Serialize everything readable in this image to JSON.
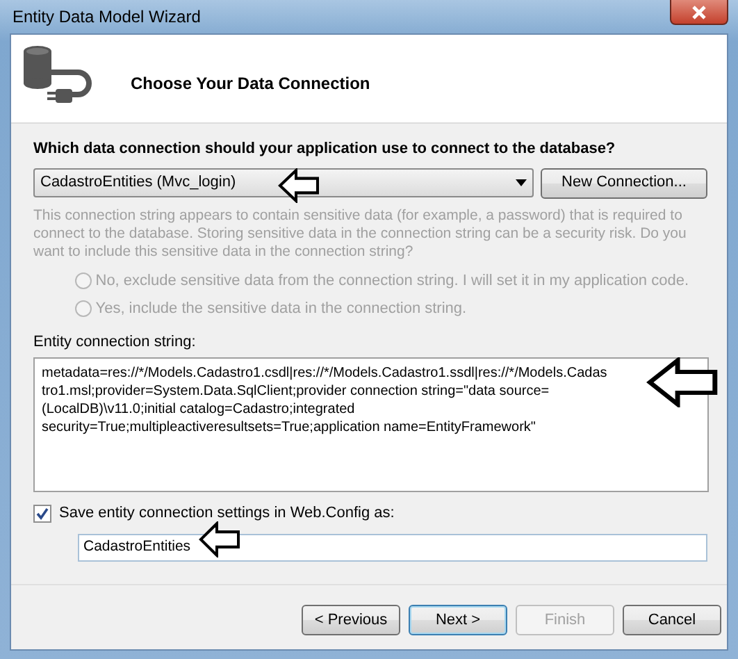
{
  "window": {
    "title": "Entity Data Model Wizard"
  },
  "header": {
    "title": "Choose Your Data Connection"
  },
  "connection": {
    "question": "Which data connection should your application use to connect to the database?",
    "value": "CadastroEntities (Mvc_login)",
    "new_button": "New Connection..."
  },
  "sensitive": {
    "text": "This connection string appears to contain sensitive data (for example, a password) that is required to connect to the database. Storing sensitive data in the connection string can be a security risk. Do you want to include this sensitive data in the connection string?",
    "disabled": true,
    "options": [
      {
        "label": "No, exclude sensitive data from the connection string. I will set it in my application code.",
        "selected": false
      },
      {
        "label": "Yes, include the sensitive data in the connection string.",
        "selected": false
      }
    ]
  },
  "entity": {
    "label": "Entity connection string:",
    "value": "metadata=res://*/Models.Cadastro1.csdl|res://*/Models.Cadastro1.ssdl|res://*/Models.Cadastro1.msl;provider=System.Data.SqlClient;provider connection string=\"data source=(LocalDB)\\v11.0;initial catalog=Cadastro;integrated security=True;multipleactiveresultsets=True;application name=EntityFramework\""
  },
  "save": {
    "label": "Save entity connection settings in Web.Config as:",
    "checked": true,
    "value": "CadastroEntities"
  },
  "buttons": [
    {
      "label": "< Previous",
      "disabled": false,
      "default": false
    },
    {
      "label": "Next >",
      "disabled": false,
      "default": true
    },
    {
      "label": "Finish",
      "disabled": true,
      "default": false
    },
    {
      "label": "Cancel",
      "disabled": false,
      "default": false
    }
  ]
}
